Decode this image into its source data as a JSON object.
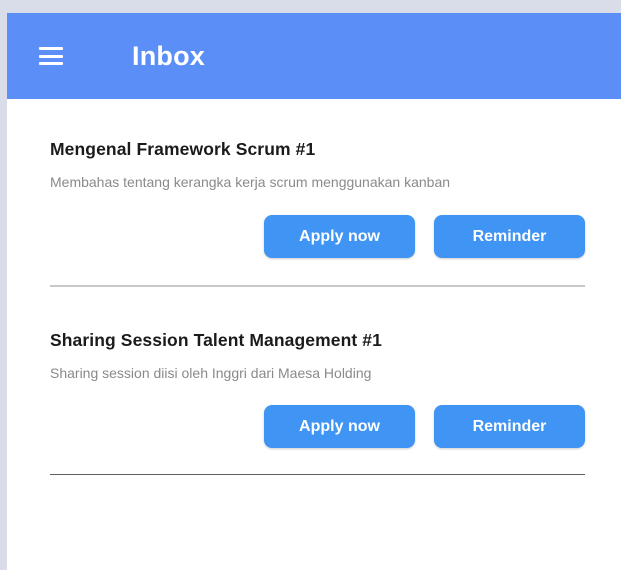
{
  "header": {
    "title": "Inbox",
    "menu_icon": "hamburger-menu-icon"
  },
  "colors": {
    "app_bar": "#5b8ff7",
    "button": "#3f94f4"
  },
  "items": [
    {
      "title": "Mengenal Framework Scrum #1",
      "description": "Membahas tentang kerangka kerja scrum menggunakan kanban",
      "apply_label": "Apply now",
      "reminder_label": "Reminder"
    },
    {
      "title": "Sharing Session Talent Management #1",
      "description": "Sharing session diisi oleh Inggri dari Maesa Holding",
      "apply_label": "Apply now",
      "reminder_label": "Reminder"
    }
  ]
}
